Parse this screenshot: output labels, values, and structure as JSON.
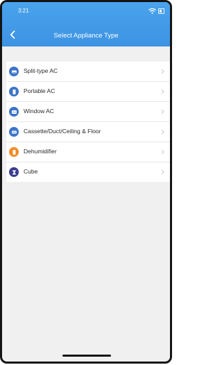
{
  "status": {
    "time": "3:21"
  },
  "header": {
    "title": "Select Appliance Type"
  },
  "colors": {
    "header": "#3d93e3",
    "icon_blue": "#3c74c8",
    "icon_orange": "#f28c28",
    "icon_navy": "#3a3c8f"
  },
  "appliances": [
    {
      "label": "Split-type AC",
      "icon": "split-ac-icon"
    },
    {
      "label": "Portable AC",
      "icon": "portable-ac-icon"
    },
    {
      "label": "Window AC",
      "icon": "window-ac-icon"
    },
    {
      "label": "Cassette/Duct/Ceiling & Floor",
      "icon": "cassette-ac-icon"
    },
    {
      "label": "Dehumidifier",
      "icon": "dehumidifier-icon"
    },
    {
      "label": "Cube",
      "icon": "cube-icon"
    }
  ]
}
